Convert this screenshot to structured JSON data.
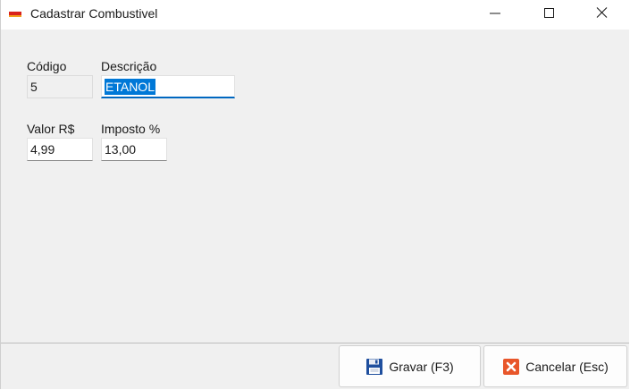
{
  "window": {
    "title": "Cadastrar Combustivel"
  },
  "form": {
    "codigo": {
      "label": "Código",
      "value": "5"
    },
    "descricao": {
      "label": "Descrição",
      "value": "ETANOL"
    },
    "valor": {
      "label": "Valor R$",
      "value": "4,99"
    },
    "imposto": {
      "label": "Imposto %",
      "value": "13,00"
    }
  },
  "footer": {
    "save_label": "Gravar (F3)",
    "cancel_label": "Cancelar (Esc)"
  },
  "icons": {
    "app": "app-logo-icon",
    "minimize": "minimize-icon",
    "maximize": "maximize-icon",
    "close": "close-icon",
    "save": "floppy-disk-icon",
    "cancel": "cancel-x-icon"
  },
  "colors": {
    "selection": "#0078d7",
    "focus_underline": "#0067c0",
    "cancel_icon": "#e8562a",
    "save_icon": "#1f4f9e"
  }
}
